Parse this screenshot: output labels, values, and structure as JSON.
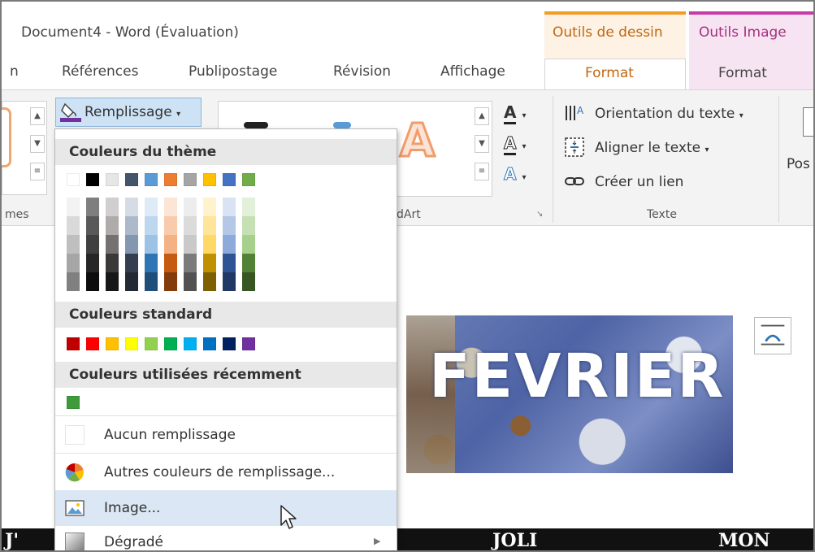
{
  "window": {
    "title": "Document4 - Word (Évaluation)"
  },
  "contextual_tabs": {
    "drawing_tools": "Outils de dessin",
    "image_tools": "Outils Image"
  },
  "tabs": {
    "cut_left": "n",
    "references": "Références",
    "mailings": "Publipostage",
    "review": "Révision",
    "view": "Affichage",
    "format_drawing": "Format",
    "format_image": "Format"
  },
  "ribbon": {
    "fill_button": "Remplissage",
    "group_labels": {
      "styles_cut": "mes",
      "wordart_cut": "dArt",
      "text": "Texte"
    },
    "text_group": {
      "orientation": "Orientation du texte",
      "align": "Aligner le texte",
      "link": "Créer un lien"
    },
    "position_cut": "Pos"
  },
  "dropdown": {
    "theme_header": "Couleurs du thème",
    "standard_header": "Couleurs standard",
    "recent_header": "Couleurs utilisées récemment",
    "theme_colors": [
      {
        "top": "#ffffff",
        "shades": [
          "#f2f2f2",
          "#d9d9d9",
          "#bfbfbf",
          "#a6a6a6",
          "#808080"
        ]
      },
      {
        "top": "#000000",
        "shades": [
          "#7f7f7f",
          "#595959",
          "#404040",
          "#262626",
          "#0d0d0d"
        ]
      },
      {
        "top": "#e7e6e6",
        "shades": [
          "#d0cece",
          "#afabab",
          "#767171",
          "#3b3838",
          "#181717"
        ]
      },
      {
        "top": "#44546a",
        "shades": [
          "#d6dce4",
          "#acb9ca",
          "#8497b0",
          "#333f4f",
          "#222a35"
        ]
      },
      {
        "top": "#5b9bd5",
        "shades": [
          "#deebf6",
          "#bdd7ee",
          "#9cc3e5",
          "#2e75b5",
          "#1e4e79"
        ]
      },
      {
        "top": "#ed7d31",
        "shades": [
          "#fbe5d5",
          "#f7cbac",
          "#f4b183",
          "#c55a11",
          "#833c0b"
        ]
      },
      {
        "top": "#a5a5a5",
        "shades": [
          "#ededed",
          "#dbdbdb",
          "#c9c9c9",
          "#7b7b7b",
          "#525252"
        ]
      },
      {
        "top": "#ffc000",
        "shades": [
          "#fff2cc",
          "#fee599",
          "#ffd965",
          "#bf9000",
          "#7f6000"
        ]
      },
      {
        "top": "#4472c4",
        "shades": [
          "#dae3f3",
          "#b4c7e7",
          "#8eaadb",
          "#2f5496",
          "#1f3864"
        ]
      },
      {
        "top": "#70ad47",
        "shades": [
          "#e2efd9",
          "#c5e0b3",
          "#a8d08d",
          "#538135",
          "#375623"
        ]
      }
    ],
    "standard_colors": [
      "#c00000",
      "#ff0000",
      "#ffc000",
      "#ffff00",
      "#92d050",
      "#00b050",
      "#00b0f0",
      "#0070c0",
      "#002060",
      "#7030a0"
    ],
    "recent_colors": [
      "#3e9a3a"
    ],
    "no_fill": "Aucun remplissage",
    "more_colors": "Autres couleurs de remplissage...",
    "picture": "Image...",
    "gradient": "Dégradé"
  },
  "document": {
    "picture_text": "FEVRIER",
    "band_texts": [
      "J'",
      "JOLI",
      "MON"
    ]
  }
}
